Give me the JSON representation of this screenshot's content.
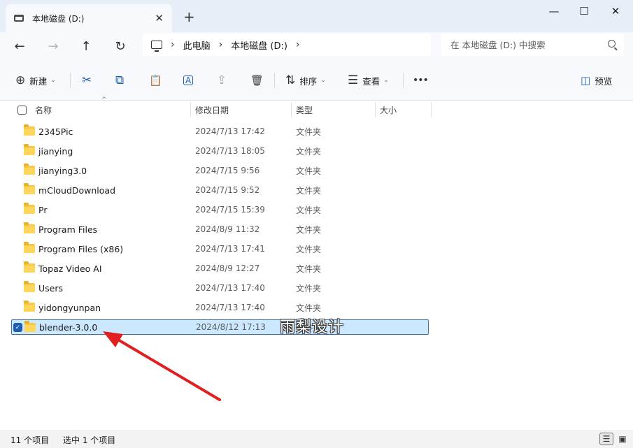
{
  "tab": {
    "title": "本地磁盘 (D:)",
    "close": "✕",
    "new_tab": "+"
  },
  "window": {
    "minimize": "—",
    "maximize": "☐",
    "close": "✕"
  },
  "nav": {
    "back": "←",
    "forward": "→",
    "up": "↑",
    "refresh": "↻"
  },
  "address": {
    "chevron": "›",
    "crumbs": [
      "此电脑",
      "本地磁盘 (D:)"
    ]
  },
  "search": {
    "placeholder": "在 本地磁盘 (D:) 中搜索"
  },
  "toolbar": {
    "new_icon": "⊕",
    "new_label": "新建",
    "cut_icon": "✂",
    "copy_icon": "⧉",
    "paste_icon": "📋",
    "rename_icon": "A",
    "share_icon": "⇪",
    "delete_icon": "🗑",
    "sort_icon": "⇅",
    "sort_label": "排序",
    "view_icon": "☰",
    "view_label": "查看",
    "more_icon": "•••",
    "preview_icon": "◫",
    "preview_label": "预览",
    "caret": "⌄"
  },
  "columns": {
    "name": "名称",
    "modified": "修改日期",
    "type": "类型",
    "size": "大小"
  },
  "files": [
    {
      "name": "2345Pic",
      "modified": "2024/7/13 17:42",
      "type": "文件夹"
    },
    {
      "name": "jianying",
      "modified": "2024/7/13 18:05",
      "type": "文件夹"
    },
    {
      "name": "jianying3.0",
      "modified": "2024/7/15 9:56",
      "type": "文件夹"
    },
    {
      "name": "mCloudDownload",
      "modified": "2024/7/15 9:52",
      "type": "文件夹"
    },
    {
      "name": "Pr",
      "modified": "2024/7/15 15:39",
      "type": "文件夹"
    },
    {
      "name": "Program Files",
      "modified": "2024/8/9 11:32",
      "type": "文件夹"
    },
    {
      "name": "Program Files (x86)",
      "modified": "2024/7/13 17:41",
      "type": "文件夹"
    },
    {
      "name": "Topaz Video AI",
      "modified": "2024/8/9 12:27",
      "type": "文件夹"
    },
    {
      "name": "Users",
      "modified": "2024/7/13 17:40",
      "type": "文件夹"
    },
    {
      "name": "yidongyunpan",
      "modified": "2024/7/13 17:40",
      "type": "文件夹"
    },
    {
      "name": "blender-3.0.0",
      "modified": "2024/8/12 17:13",
      "type": "文件夹",
      "selected": true
    }
  ],
  "watermark": "雨梨设计",
  "status": {
    "count": "11 个项目",
    "selected": "选中 1 个项目"
  },
  "colors": {
    "selection": "#cce8ff",
    "accent": "#1f5fb3",
    "arrow": "#e02020",
    "folder": "#f7c948"
  }
}
